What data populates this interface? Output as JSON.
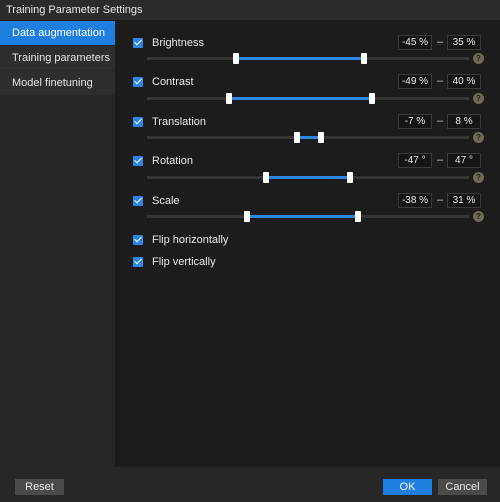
{
  "window": {
    "title": "Training Parameter Settings"
  },
  "sidebar": {
    "items": [
      {
        "label": "Data augmentation",
        "active": true
      },
      {
        "label": "Training parameters",
        "active": false
      },
      {
        "label": "Model finetuning",
        "active": false
      }
    ]
  },
  "params": [
    {
      "label": "Brightness",
      "checked": true,
      "min_text": "-45 %",
      "max_text": "35 %",
      "range_start": 0.275,
      "range_end": 0.675,
      "has_help": true
    },
    {
      "label": "Contrast",
      "checked": true,
      "min_text": "-49 %",
      "max_text": "40 %",
      "range_start": 0.255,
      "range_end": 0.7,
      "has_help": true
    },
    {
      "label": "Translation",
      "checked": true,
      "min_text": "-7 %",
      "max_text": "8 %",
      "range_start": 0.465,
      "range_end": 0.54,
      "has_help": true
    },
    {
      "label": "Rotation",
      "checked": true,
      "min_text": "-47 °",
      "max_text": "47 °",
      "range_start": 0.369,
      "range_end": 0.631,
      "has_help": true
    },
    {
      "label": "Scale",
      "checked": true,
      "min_text": "-38 %",
      "max_text": "31 %",
      "range_start": 0.31,
      "range_end": 0.655,
      "has_help": true
    }
  ],
  "flags": [
    {
      "label": "Flip horizontally",
      "checked": true
    },
    {
      "label": "Flip vertically",
      "checked": true
    }
  ],
  "footer": {
    "reset_label": "Reset",
    "ok_label": "OK",
    "cancel_label": "Cancel"
  },
  "colors": {
    "accent": "#1e7fe0",
    "background": "#1c1c1c",
    "sidebar": "#262626"
  },
  "icons": {
    "checkbox": "checkmark-icon",
    "help": "question-mark-icon"
  }
}
